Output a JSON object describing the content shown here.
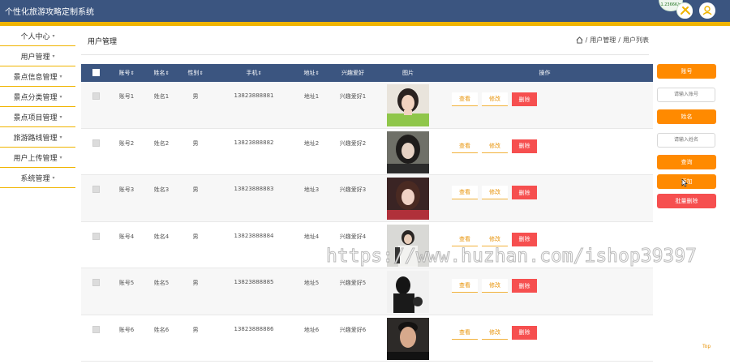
{
  "header": {
    "app_title": "个性化旅游攻略定制系统",
    "widget_text": "1.2366K/s"
  },
  "colors": {
    "header_bg": "#3b5580",
    "accent": "#f0b400",
    "orange": "#ff8a00",
    "danger": "#f64f4f"
  },
  "sidebar": {
    "items": [
      {
        "label": "个人中心"
      },
      {
        "label": "用户管理"
      },
      {
        "label": "景点信息管理"
      },
      {
        "label": "景点分类管理"
      },
      {
        "label": "景点项目管理"
      },
      {
        "label": "旅游路线管理"
      },
      {
        "label": "用户上传管理"
      },
      {
        "label": "系统管理"
      }
    ]
  },
  "page": {
    "title": "用户管理",
    "breadcrumb": {
      "sep": "/",
      "level1": "用户管理",
      "level2": "用户列表"
    }
  },
  "table": {
    "columns": [
      "账号",
      "姓名",
      "性别",
      "手机",
      "地址",
      "兴趣爱好",
      "图片",
      "操作"
    ],
    "rows": [
      {
        "account": "账号1",
        "name": "姓名1",
        "gender": "男",
        "phone": "13823888881",
        "address": "地址1",
        "hobby": "兴趣爱好1"
      },
      {
        "account": "账号2",
        "name": "姓名2",
        "gender": "男",
        "phone": "13823888882",
        "address": "地址2",
        "hobby": "兴趣爱好2"
      },
      {
        "account": "账号3",
        "name": "姓名3",
        "gender": "男",
        "phone": "13823888883",
        "address": "地址3",
        "hobby": "兴趣爱好3"
      },
      {
        "account": "账号4",
        "name": "姓名4",
        "gender": "男",
        "phone": "13823888884",
        "address": "地址4",
        "hobby": "兴趣爱好4"
      },
      {
        "account": "账号5",
        "name": "姓名5",
        "gender": "男",
        "phone": "13823888885",
        "address": "地址5",
        "hobby": "兴趣爱好5"
      },
      {
        "account": "账号6",
        "name": "姓名6",
        "gender": "男",
        "phone": "13823888886",
        "address": "地址6",
        "hobby": "兴趣爱好6"
      }
    ],
    "actions": {
      "view": "查看",
      "edit": "修改",
      "delete": "删除"
    }
  },
  "search_panel": {
    "account_label": "账号",
    "account_placeholder": "请输入账号",
    "name_label": "姓名",
    "name_placeholder": "请输入姓名",
    "search_button": "查询",
    "add_button": "添加",
    "bulk_delete_button": "批量删除"
  },
  "footer": {
    "top_link": "Top"
  },
  "watermark": "https://www.huzhan.com/ishop39397"
}
